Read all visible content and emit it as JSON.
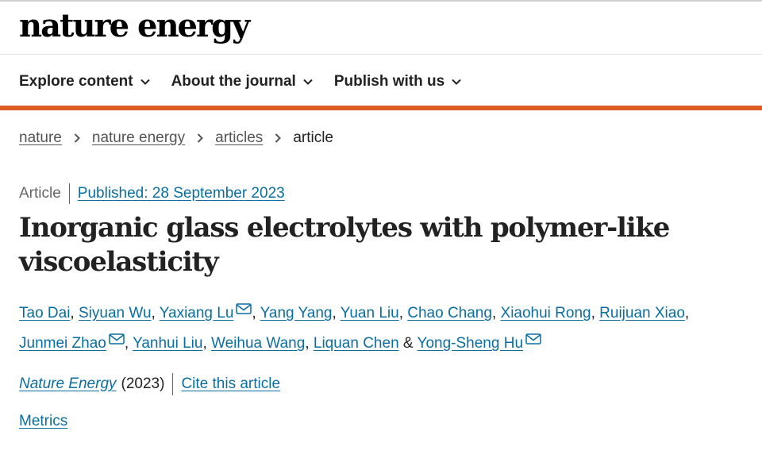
{
  "site": {
    "logo": "nature energy"
  },
  "nav": {
    "items": [
      {
        "label": "Explore content"
      },
      {
        "label": "About the journal"
      },
      {
        "label": "Publish with us"
      }
    ]
  },
  "breadcrumb": {
    "links": [
      "nature",
      "nature energy",
      "articles"
    ],
    "current": "article"
  },
  "article": {
    "type": "Article",
    "published": "Published: 28 September 2023",
    "title": "Inorganic glass electrolytes with polymer-like viscoelasticity",
    "authors": [
      "Tao Dai",
      "Siyuan Wu",
      "Yaxiang Lu",
      "Yang Yang",
      "Yuan Liu",
      "Chao Chang",
      "Xiaohui Rong",
      "Ruijuan Xiao",
      "Junmei Zhao",
      "Yanhui Liu",
      "Weihua Wang",
      "Liquan Chen",
      "Yong-Sheng Hu"
    ],
    "author_conj": "&",
    "journal": "Nature Energy",
    "year": "(2023)",
    "cite": "Cite this article",
    "metrics": "Metrics"
  },
  "colors": {
    "accent_bar": "#e05a23",
    "link": "#0a6ea3"
  },
  "icons": {
    "nav_chevron": "chevron-down-icon",
    "breadcrumb_sep": "chevron-right-icon",
    "author_mail": "mail-icon"
  }
}
